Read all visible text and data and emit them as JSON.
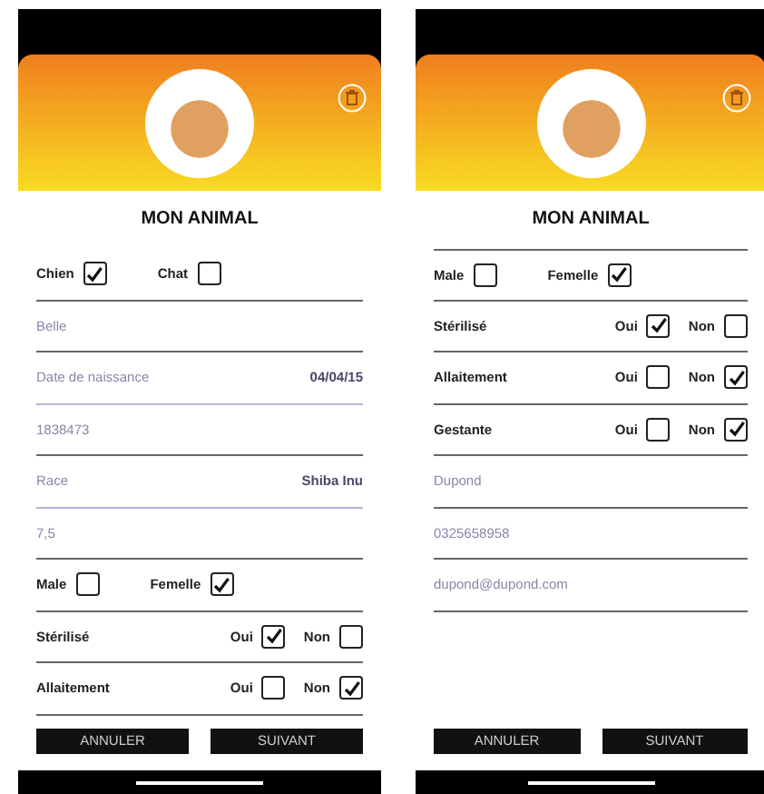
{
  "screens": [
    {
      "title": "MON ANIMAL",
      "top_rule": false,
      "rows": [
        {
          "kind": "choice",
          "options": [
            {
              "label": "Chien",
              "checked": true
            },
            {
              "label": "Chat",
              "checked": false
            }
          ]
        },
        {
          "kind": "field",
          "value": "Belle"
        },
        {
          "kind": "field",
          "label": "Date de naissance",
          "value": "04/04/15"
        },
        {
          "kind": "field",
          "value": "1838473"
        },
        {
          "kind": "field",
          "label": "Race",
          "value": "Shiba Inu"
        },
        {
          "kind": "field",
          "value": "7,5"
        },
        {
          "kind": "choice",
          "options": [
            {
              "label": "Male",
              "checked": false
            },
            {
              "label": "Femelle",
              "checked": true
            }
          ]
        },
        {
          "kind": "yesno",
          "label": "Stérilisé",
          "options": [
            {
              "label": "Oui",
              "checked": true
            },
            {
              "label": "Non",
              "checked": false
            }
          ]
        },
        {
          "kind": "yesno",
          "label": "Allaitement",
          "options": [
            {
              "label": "Oui",
              "checked": false
            },
            {
              "label": "Non",
              "checked": true
            }
          ]
        }
      ],
      "buttons": [
        "ANNULER",
        "SUIVANT"
      ]
    },
    {
      "title": "MON ANIMAL",
      "top_rule": true,
      "rows": [
        {
          "kind": "choice",
          "options": [
            {
              "label": "Male",
              "checked": false
            },
            {
              "label": "Femelle",
              "checked": true
            }
          ]
        },
        {
          "kind": "yesno",
          "label": "Stérilisé",
          "options": [
            {
              "label": "Oui",
              "checked": true
            },
            {
              "label": "Non",
              "checked": false
            }
          ]
        },
        {
          "kind": "yesno",
          "label": "Allaitement",
          "options": [
            {
              "label": "Oui",
              "checked": false
            },
            {
              "label": "Non",
              "checked": true
            }
          ]
        },
        {
          "kind": "yesno",
          "label": "Gestante",
          "options": [
            {
              "label": "Oui",
              "checked": false
            },
            {
              "label": "Non",
              "checked": true
            }
          ]
        },
        {
          "kind": "field",
          "value": "Dupond"
        },
        {
          "kind": "field",
          "value": "0325658958"
        },
        {
          "kind": "field",
          "value": "dupond@dupond.com"
        }
      ],
      "buttons": [
        "ANNULER",
        "SUIVANT"
      ]
    }
  ]
}
